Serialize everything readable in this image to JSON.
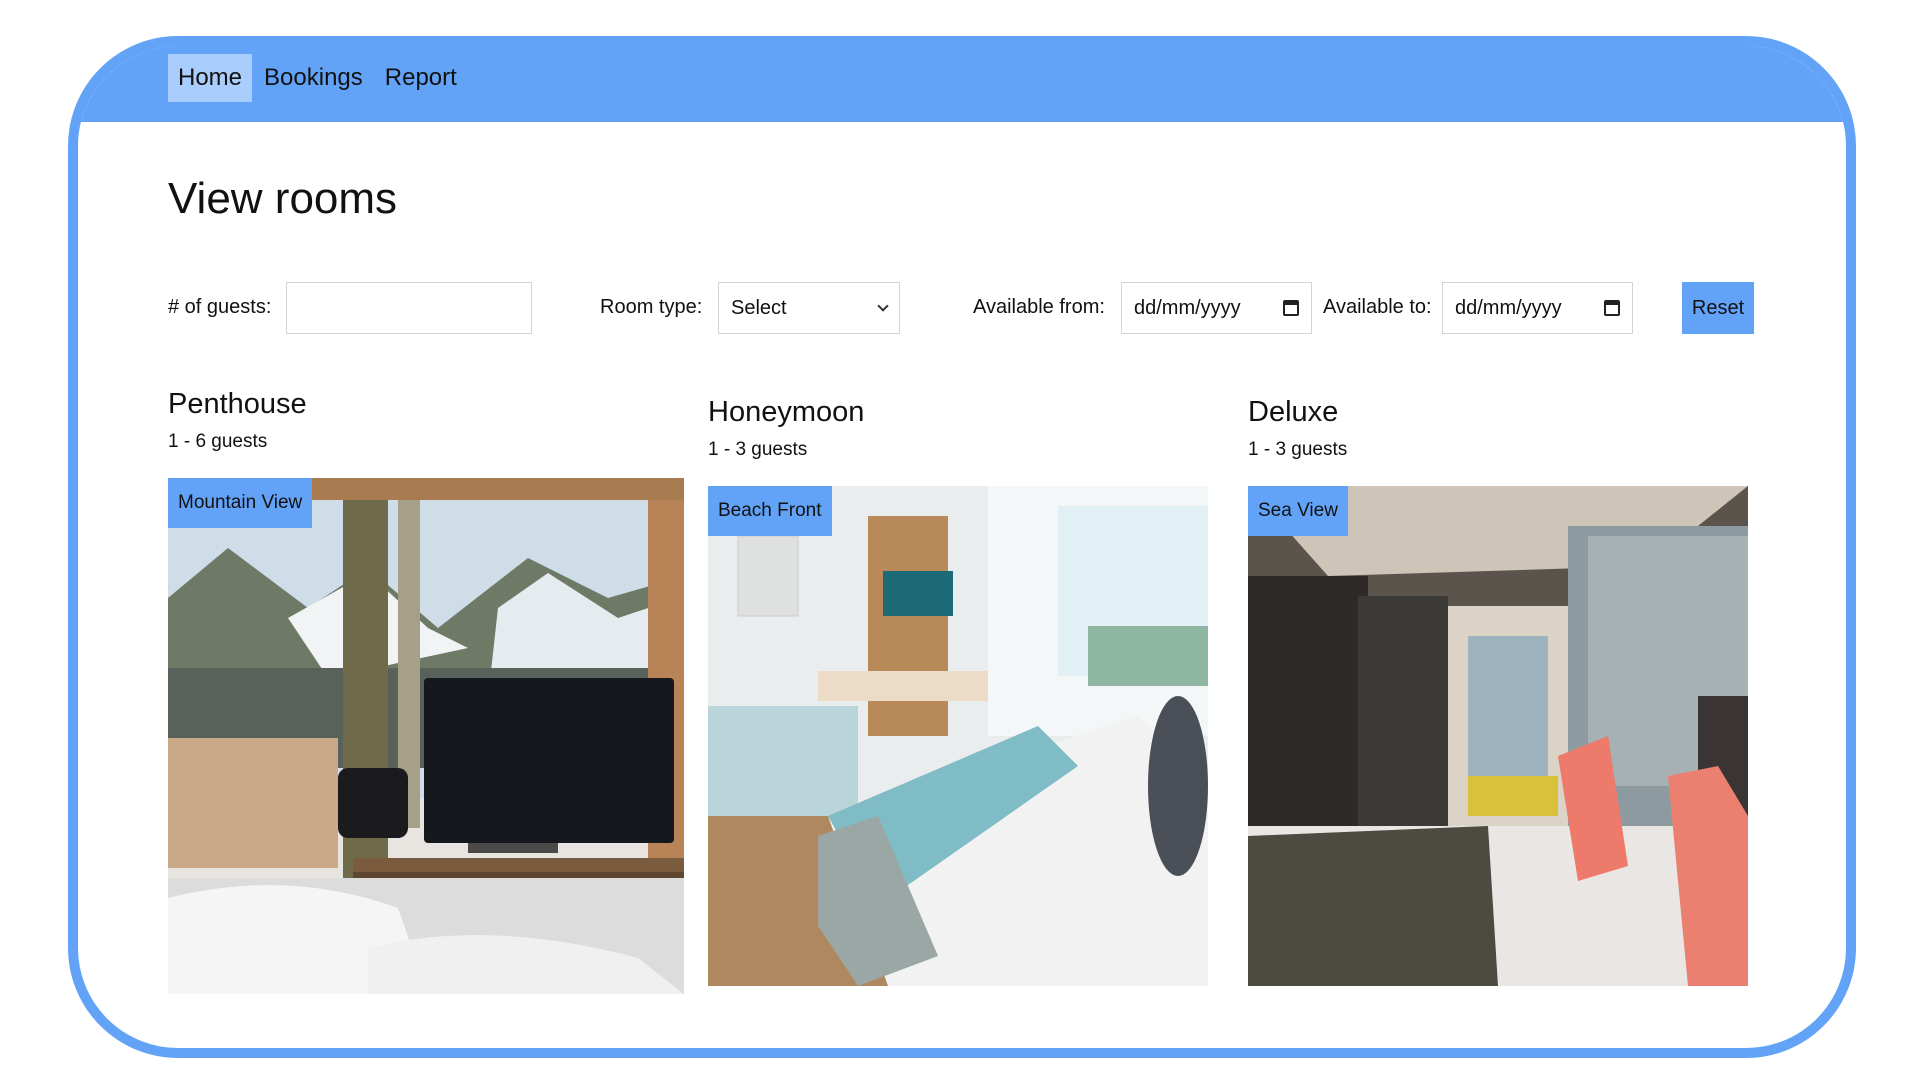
{
  "nav": {
    "items": [
      {
        "label": "Home",
        "active": true
      },
      {
        "label": "Bookings",
        "active": false
      },
      {
        "label": "Report",
        "active": false
      }
    ]
  },
  "page": {
    "title": "View rooms"
  },
  "filters": {
    "guests_label": "# of guests:",
    "guests_value": "",
    "room_type_label": "Room type:",
    "room_type_value": "Select",
    "available_from_label": "Available from:",
    "available_from_value": "dd/mm/yyyy",
    "available_to_label": "Available to:",
    "available_to_value": "dd/mm/yyyy",
    "reset_label": "Reset"
  },
  "rooms": [
    {
      "name": "Penthouse",
      "guests": "1 - 6 guests",
      "tag": "Mountain View"
    },
    {
      "name": "Honeymoon",
      "guests": "1 - 3 guests",
      "tag": "Beach Front"
    },
    {
      "name": "Deluxe",
      "guests": "1 - 3 guests",
      "tag": "Sea View"
    }
  ],
  "colors": {
    "accent": "#62a3f8",
    "nav_active": "#a9cdfd"
  }
}
